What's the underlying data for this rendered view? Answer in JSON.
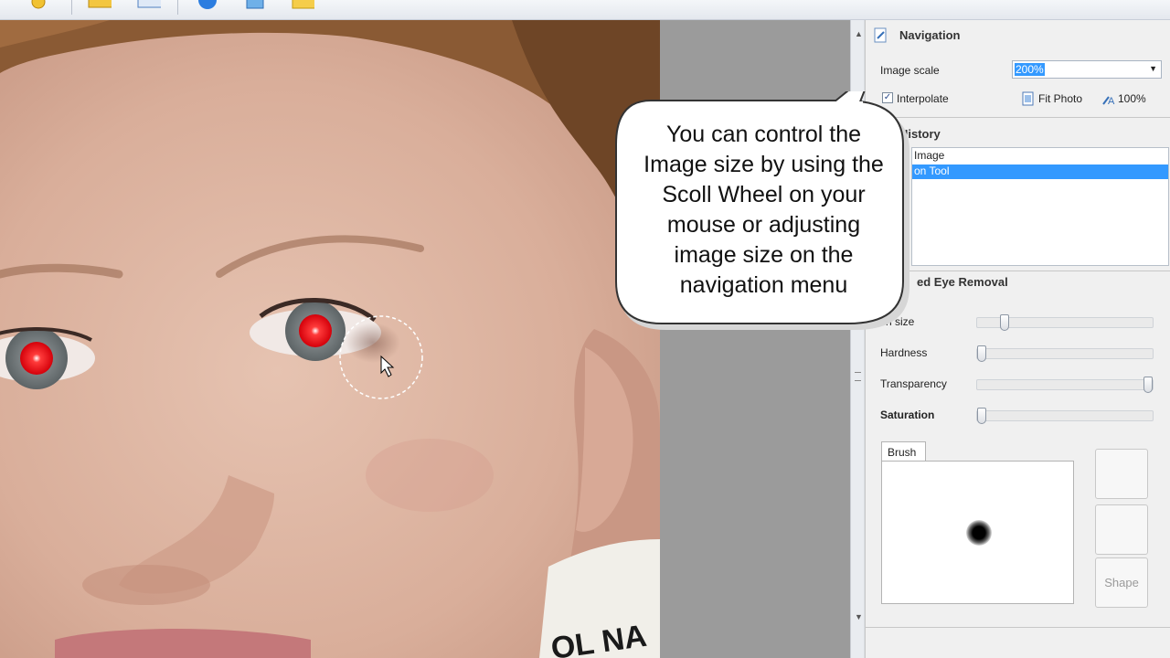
{
  "toolbar": {
    "icons": [
      "folder-open-icon",
      "save-icon",
      "info-icon",
      "share-icon",
      "folder-icon"
    ]
  },
  "navigation": {
    "title": "Navigation",
    "image_scale_label": "Image scale",
    "image_scale_value": "200%",
    "interpolate_label": "Interpolate",
    "interpolate_checked": true,
    "fit_photo_label": "Fit Photo",
    "zoom_100_label": "100%"
  },
  "history": {
    "title": "History",
    "items": [
      {
        "label": "Image",
        "selected": false
      },
      {
        "label": "on Tool",
        "selected": true
      }
    ]
  },
  "red_eye": {
    "title": "ed Eye Removal",
    "sliders": [
      {
        "label": "sh size",
        "level": 0.15,
        "bold": false
      },
      {
        "label": "Hardness",
        "level": 0.0,
        "bold": false
      },
      {
        "label": "Transparency",
        "level": 1.0,
        "bold": false
      },
      {
        "label": "Saturation",
        "level": 0.0,
        "bold": true
      }
    ],
    "brush_tab": "Brush",
    "shape_button": "Shape"
  },
  "callout": {
    "lines": [
      "You can control the",
      "Image size by using the",
      "Scoll Wheel on your",
      "mouse or adjusting",
      "image size on the",
      "navigation menu"
    ]
  },
  "colors": {
    "selection": "#3399ff",
    "canvas_gray": "#9b9b9b",
    "red_eye": "#e8101a"
  }
}
